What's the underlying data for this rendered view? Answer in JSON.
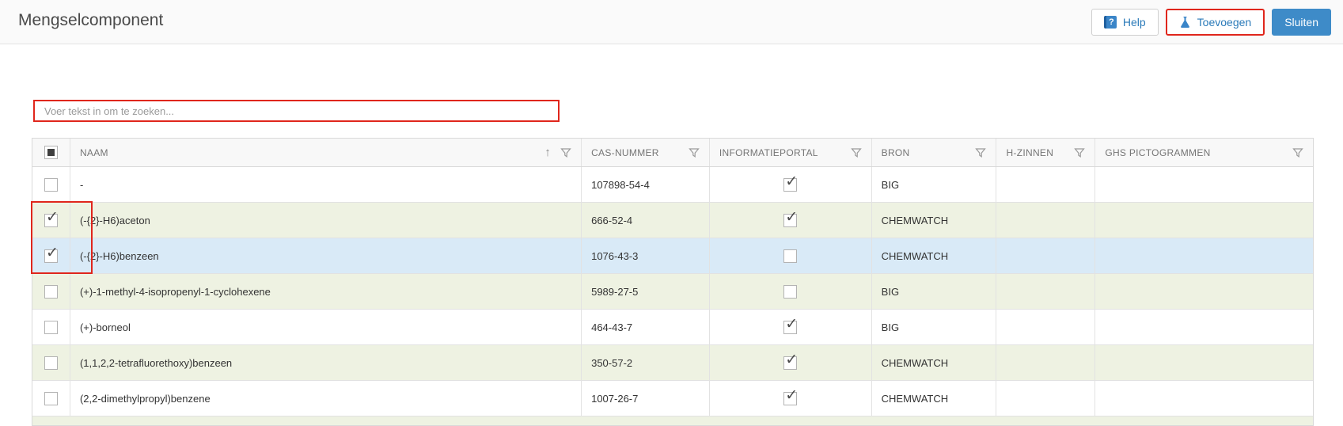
{
  "header": {
    "title": "Mengselcomponent",
    "help_label": "Help",
    "add_label": "Toevoegen",
    "close_label": "Sluiten"
  },
  "search": {
    "placeholder": "Voer tekst in om te zoeken..."
  },
  "table": {
    "columns": {
      "naam": "NAAM",
      "cas": "CAS-NUMMER",
      "portal": "INFORMATIEPORTAL",
      "bron": "BRON",
      "h_zinnen": "H-ZINNEN",
      "ghs": "GHS PICTOGRAMMEN"
    },
    "select_all_state": "indeterminate",
    "sort": {
      "column": "NAAM",
      "direction": "ascending"
    },
    "rows": [
      {
        "checked": false,
        "name": "-",
        "cas": "107898-54-4",
        "portal": true,
        "bron": "BIG",
        "h_zinnen": "",
        "ghs": "",
        "selected": false
      },
      {
        "checked": true,
        "name": "(-{2}-H6)aceton",
        "cas": "666-52-4",
        "portal": true,
        "bron": "CHEMWATCH",
        "h_zinnen": "",
        "ghs": "",
        "selected": false
      },
      {
        "checked": true,
        "name": "(-{2}-H6)benzeen",
        "cas": "1076-43-3",
        "portal": false,
        "bron": "CHEMWATCH",
        "h_zinnen": "",
        "ghs": "",
        "selected": true
      },
      {
        "checked": false,
        "name": "(+)-1-methyl-4-isopropenyl-1-cyclohexene",
        "cas": "5989-27-5",
        "portal": false,
        "bron": "BIG",
        "h_zinnen": "",
        "ghs": "",
        "selected": false
      },
      {
        "checked": false,
        "name": "(+)-borneol",
        "cas": "464-43-7",
        "portal": true,
        "bron": "BIG",
        "h_zinnen": "",
        "ghs": "",
        "selected": false
      },
      {
        "checked": false,
        "name": "(1,1,2,2-tetrafluorethoxy)benzeen",
        "cas": "350-57-2",
        "portal": true,
        "bron": "CHEMWATCH",
        "h_zinnen": "",
        "ghs": "",
        "selected": false
      },
      {
        "checked": false,
        "name": "(2,2-dimethylpropyl)benzene",
        "cas": "1007-26-7",
        "portal": true,
        "bron": "CHEMWATCH",
        "h_zinnen": "",
        "ghs": "",
        "selected": false
      }
    ]
  },
  "icons": {
    "help": "book-question-icon",
    "add": "flask-icon",
    "sort_asc_glyph": "↑",
    "check_glyph": "✓",
    "help_glyph": "?",
    "filter": "funnel-icon"
  },
  "colors": {
    "primary_button": "#3e8bc8",
    "link_blue": "#2a7ab9",
    "annotation_red": "#e0261c",
    "row_green": "#eef2e2",
    "row_selected_blue": "#d9eaf7",
    "header_bg": "#f8f8f8"
  }
}
